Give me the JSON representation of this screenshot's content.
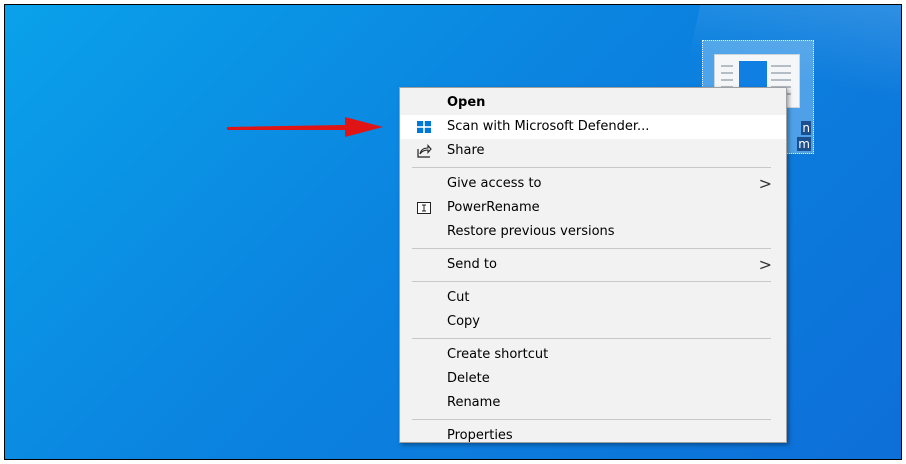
{
  "desktop": {
    "icon": {
      "label_line1": "n",
      "label_line2": "m"
    }
  },
  "context_menu": {
    "items": [
      {
        "label": "Open",
        "icon": "none"
      },
      {
        "label": "Scan with Microsoft Defender...",
        "icon": "defender-shield-icon"
      },
      {
        "label": "Share",
        "icon": "share-icon"
      },
      {
        "label": "Give access to",
        "submenu": true
      },
      {
        "label": "PowerRename",
        "icon": "power-rename-icon"
      },
      {
        "label": "Restore previous versions"
      },
      {
        "label": "Send to",
        "submenu": true
      },
      {
        "label": "Cut"
      },
      {
        "label": "Copy"
      },
      {
        "label": "Create shortcut"
      },
      {
        "label": "Delete"
      },
      {
        "label": "Rename"
      },
      {
        "label": "Properties"
      }
    ],
    "chevron": ">"
  },
  "colors": {
    "desktop_background": "#0b84e0",
    "menu_background": "#f2f2f2",
    "arrow": "#e01414",
    "defender_blue": "#0078d7"
  }
}
